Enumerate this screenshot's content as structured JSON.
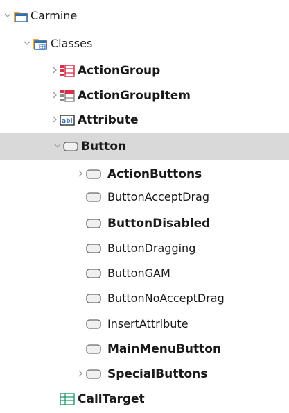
{
  "tree": {
    "root": {
      "label": "Carmine",
      "expanded": true
    },
    "classes": {
      "label": "Classes",
      "expanded": true
    },
    "action_group": {
      "label": "ActionGroup",
      "expanded": false
    },
    "action_group_item": {
      "label": "ActionGroupItem",
      "expanded": false
    },
    "attribute": {
      "label": "Attribute",
      "expanded": false
    },
    "button": {
      "label": "Button",
      "expanded": true,
      "selected": true
    },
    "action_buttons": {
      "label": "ActionButtons",
      "expanded": false
    },
    "button_accept_drag": {
      "label": "ButtonAcceptDrag"
    },
    "button_disabled": {
      "label": "ButtonDisabled"
    },
    "button_dragging": {
      "label": "ButtonDragging"
    },
    "button_gam": {
      "label": "ButtonGAM"
    },
    "button_no_accept_drag": {
      "label": "ButtonNoAcceptDrag"
    },
    "insert_attribute": {
      "label": "InsertAttribute"
    },
    "main_menu_button": {
      "label": "MainMenuButton"
    },
    "special_buttons": {
      "label": "SpecialButtons",
      "expanded": false
    },
    "call_target": {
      "label": "CallTarget"
    }
  },
  "colors": {
    "selection": "#d9d9d9",
    "folder_orange": "#f5a623",
    "folder_blue": "#2f6db5",
    "list_red": "#d9304a",
    "chevron": "#9a9a9a"
  }
}
